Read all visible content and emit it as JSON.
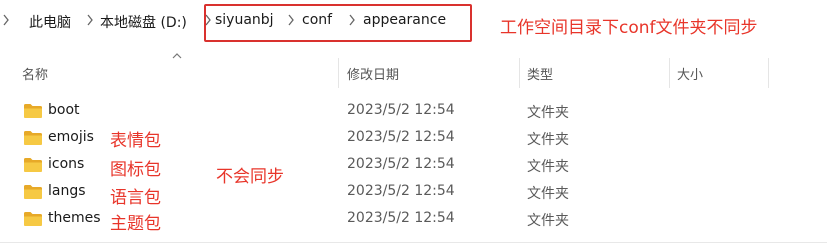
{
  "breadcrumb": {
    "items": [
      "此电脑",
      "本地磁盘 (D:)",
      "siyuanbj",
      "conf",
      "appearance"
    ]
  },
  "annotations": {
    "header_note": "工作空间目录下conf文件夹不同步",
    "not_synced": "不会同步",
    "emojis_note": "表情包",
    "icons_note": "图标包",
    "langs_note": "语言包",
    "themes_note": "主题包"
  },
  "columns": {
    "name": "名称",
    "modified": "修改日期",
    "type": "类型",
    "size": "大小"
  },
  "files": [
    {
      "name": "boot",
      "modified": "2023/5/2 12:54",
      "type": "文件夹",
      "size": ""
    },
    {
      "name": "emojis",
      "modified": "2023/5/2 12:54",
      "type": "文件夹",
      "size": ""
    },
    {
      "name": "icons",
      "modified": "2023/5/2 12:54",
      "type": "文件夹",
      "size": ""
    },
    {
      "name": "langs",
      "modified": "2023/5/2 12:54",
      "type": "文件夹",
      "size": ""
    },
    {
      "name": "themes",
      "modified": "2023/5/2 12:54",
      "type": "文件夹",
      "size": ""
    }
  ],
  "colors": {
    "annotation_red": "#e8352a",
    "folder_yellow": "#f3c13c"
  },
  "icons": {
    "breadcrumb_separator": "chevron-right-icon",
    "folder": "folder-icon",
    "sort": "sort-up-icon"
  }
}
